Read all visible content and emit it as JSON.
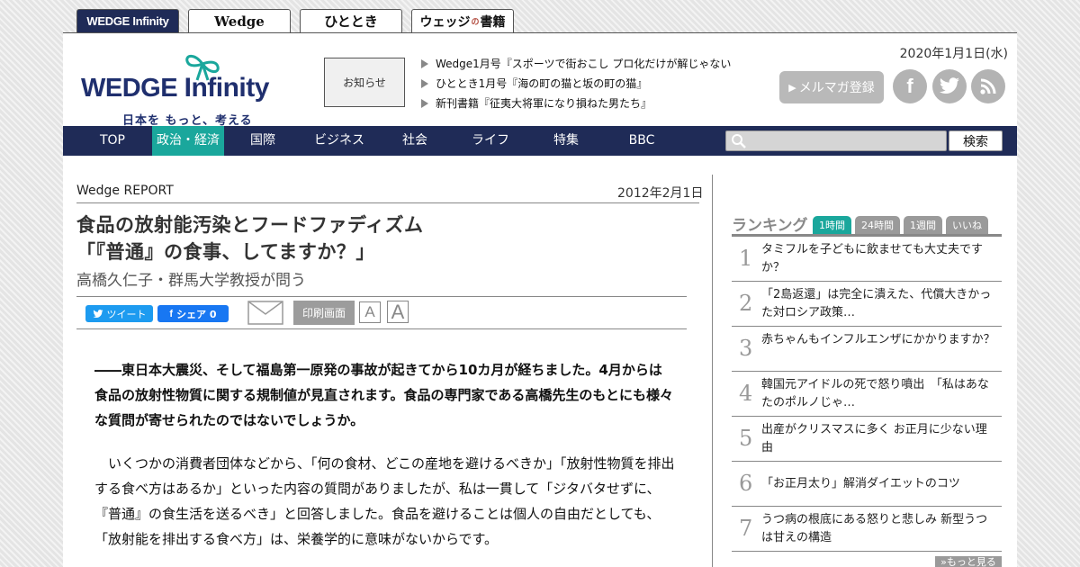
{
  "site_tabs": [
    {
      "label": "WEDGE Infinity"
    },
    {
      "label": "Wedge"
    },
    {
      "label": "ひととき"
    },
    {
      "label_main": "ウェッジ",
      "label_sub": "の",
      "label_end": "書籍"
    }
  ],
  "header": {
    "logo_word_a": "WEDGE ",
    "logo_word_b": "Infinity",
    "logo_tagline": "日本を もっと、考える",
    "notice_label": "お知らせ",
    "news": [
      "Wedge1月号『スポーツで街おこし プロ化だけが解じゃない",
      "ひととき1月号『海の町の猫と坂の町の猫』",
      "新刊書籍『征夷大将軍になり損ねた男たち』"
    ],
    "date": "2020年1月1日(水)",
    "mailmag_label": "メルマガ登録",
    "social_icons": [
      "facebook-icon",
      "twitter-icon",
      "rss-icon"
    ]
  },
  "nav": {
    "items": [
      "TOP",
      "政治・経済",
      "国際",
      "ビジネス",
      "社会",
      "ライフ",
      "特集",
      "BBC"
    ],
    "active_index": 1,
    "search_placeholder": "",
    "search_button": "検索"
  },
  "article": {
    "category": "Wedge REPORT",
    "date": "2012年2月1日",
    "title_line1": "食品の放射能汚染とフードファディズム",
    "title_line2": "「『普通』の食事、してますか？」",
    "author": "高橋久仁子・群馬大学教授が問う",
    "share": {
      "tweet": "ツイート",
      "fb_share": "シェア 0",
      "print": "印刷画面",
      "font_small": "A",
      "font_large": "A"
    },
    "lead": "――東日本大震災、そして福島第一原発の事故が起きてから10カ月が経ちました。4月からは食品の放射性物質に関する規制値が見直されます。食品の専門家である高橋先生のもとにも様々な質問が寄せられたのではないでしょうか。",
    "body": "いくつかの消費者団体などから、「何の食材、どこの産地を避けるべきか」「放射性物質を排出する食べ方はあるか」といった内容の質問がありましたが、私は一貫して「ジタバタせずに、『普通』の食生活を送るべき」と回答しました。食品を避けることは個人の自由だとしても、「放射能を排出する食べ方」は、栄養学的に意味がないからです。"
  },
  "ranking": {
    "title": "ランキング",
    "tabs": [
      "1時間",
      "24時間",
      "1週間",
      "いいね"
    ],
    "active_tab": 0,
    "items": [
      {
        "rank": "1",
        "text": "タミフルを子どもに飲ませても大丈夫ですか？"
      },
      {
        "rank": "2",
        "text": "「2島返還」は完全に潰えた、代償大きかった対ロシア政策…"
      },
      {
        "rank": "3",
        "text": "赤ちゃんもインフルエンザにかかりますか？"
      },
      {
        "rank": "4",
        "text": "韓国元アイドルの死で怒り噴出　「私はあなたのポルノじゃ…"
      },
      {
        "rank": "5",
        "text": "出産がクリスマスに多く お正月に少ない理由"
      },
      {
        "rank": "6",
        "text": "「お正月太り」解消ダイエットのコツ"
      },
      {
        "rank": "7",
        "text": "うつ病の根底にある怒りと悲しみ 新型うつは甘えの構造"
      }
    ],
    "more_label": "»もっと見る"
  },
  "colors": {
    "navy": "#1f2b57",
    "teal": "#1aa79c",
    "tweet_blue": "#1d9bf0",
    "facebook_blue": "#1877f2"
  }
}
